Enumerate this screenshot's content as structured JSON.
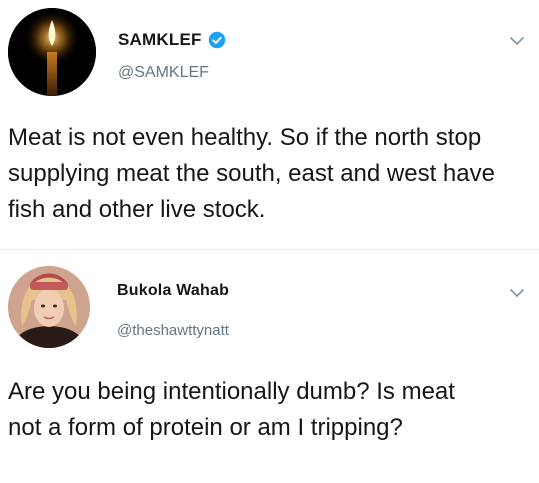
{
  "tweets": [
    {
      "display_name": "SAMKLEF",
      "verified": true,
      "handle": "@SAMKLEF",
      "avatar": "candle-flame-avatar",
      "text": "Meat is not even healthy. So if the north stop supplying meat the south, east and west have fish and other live stock."
    },
    {
      "display_name": "Bukola Wahab",
      "verified": false,
      "handle": "@theshawttynatt",
      "avatar": "user-photo-avatar",
      "text": "Are you being intentionally dumb? Is meat not a form of protein or am I tripping?"
    }
  ],
  "colors": {
    "text": "#14171a",
    "secondary": "#657786",
    "verified_blue": "#1da1f2",
    "divider": "#e6ecf0"
  },
  "icons": {
    "verified": "verified-badge-icon",
    "menu": "chevron-down-icon"
  }
}
